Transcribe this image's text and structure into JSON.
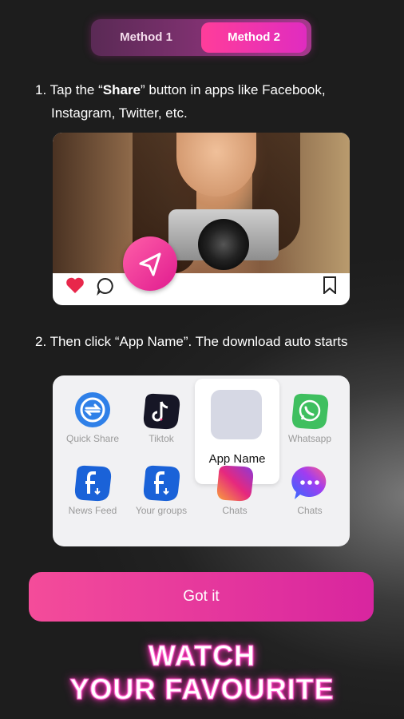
{
  "tabs": {
    "method1": "Method 1",
    "method2": "Method 2"
  },
  "step1": {
    "number": "1.",
    "prefix": "Tap the “",
    "bold": "Share",
    "suffix": "” button in apps like Facebook,",
    "line2": "Instagram, Twitter, etc."
  },
  "step2": {
    "text": "2. Then click “App Name”. The download auto starts"
  },
  "apps": [
    {
      "label": "Quick Share",
      "icon": "quick-share-icon"
    },
    {
      "label": "Tiktok",
      "icon": "tiktok-icon"
    },
    {
      "label": "Whatsapp",
      "icon": "whatsapp-icon"
    },
    {
      "label": "News Feed",
      "icon": "facebook-news-feed-icon"
    },
    {
      "label": "Your groups",
      "icon": "facebook-groups-icon"
    },
    {
      "label": "Chats",
      "icon": "instagram-chats-icon"
    },
    {
      "label": "Chats",
      "icon": "messenger-chats-icon"
    }
  ],
  "highlight": {
    "name": "App Name"
  },
  "button": {
    "label": "Got it"
  },
  "headline": {
    "line1": "WATCH",
    "line2": "YOUR FAVOURITE"
  },
  "colors": {
    "accent": "#e6249f",
    "accent_light": "#ff4fa0",
    "background": "#1f1f1f"
  }
}
